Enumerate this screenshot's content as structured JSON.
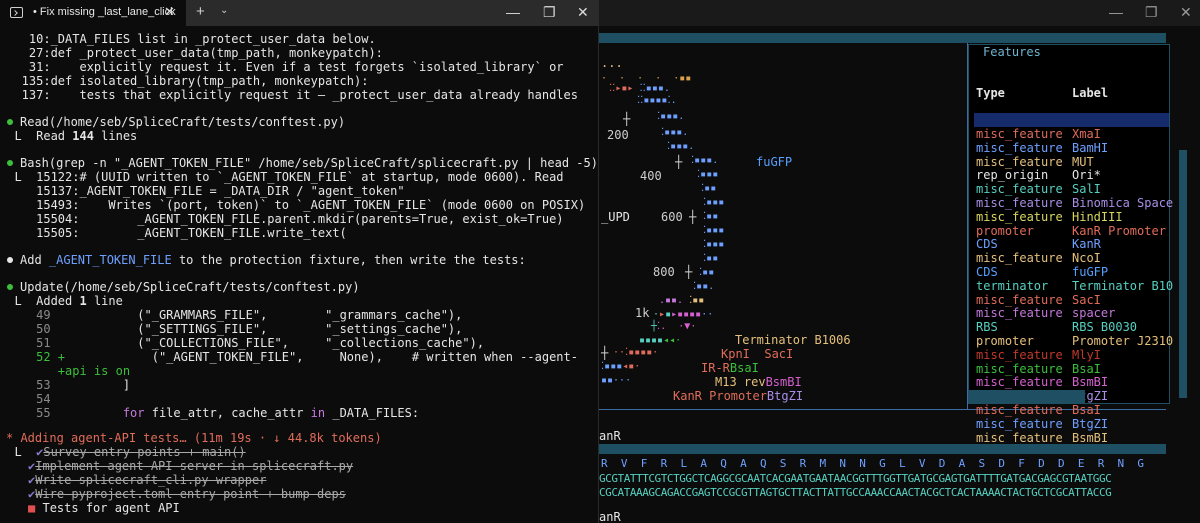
{
  "left_window": {
    "tab_title": "• Fix missing _last_lane_click",
    "close_glyph": "✕",
    "newtab_glyph": "+",
    "dropdown_glyph": "⌄",
    "min_glyph": "—",
    "max_glyph": "❐",
    "winclose_glyph": "✕"
  },
  "terminal": {
    "lines": {
      "l1": "    10:_DATA_FILES list in _protect_user_data below.",
      "l2": "    27:def _protect_user_data(tmp_path, monkeypatch):",
      "l3": "    31:    explicitly request it. Even if a test forgets `isolated_library` or",
      "l4": "   135:def isolated_library(tmp_path, monkeypatch):",
      "l5": "   137:    tests that explicitly request it — _protect_user_data already handles",
      "read_cmd": "Read(/home/seb/SpliceCraft/tests/conftest.py)",
      "read_res_prefix": "  L  Read ",
      "read_res_count": "144",
      "read_res_suffix": " lines",
      "bash_cmd": "Bash(grep -n \"_AGENT_TOKEN_FILE\" /home/seb/SpliceCraft/splicecraft.py | head -5)",
      "b1": "  L  15122:# (UUID written to `_AGENT_TOKEN_FILE` at startup, mode 0600). Read",
      "b2": "     15137:_AGENT_TOKEN_FILE = _DATA_DIR / \"agent_token\"",
      "b3": "     15493:    Writes `(port, token)` to `_AGENT_TOKEN_FILE` (mode 0600 on POSIX)",
      "b4": "     15504:        _AGENT_TOKEN_FILE.parent.mkdir(parents=True, exist_ok=True)",
      "b5": "     15505:        _AGENT_TOKEN_FILE.write_text(",
      "add_prefix": "Add ",
      "add_ident": "_AGENT_TOKEN_FILE",
      "add_suffix": " to the protection fixture, then write the tests:",
      "update_cmd": "Update(/home/seb/SpliceCraft/tests/conftest.py)",
      "added_prefix": "  L  Added ",
      "added_count": "1",
      "added_suffix": " line",
      "d49_num": "     49",
      "d49_code": "            (\"_GRAMMARS_FILE\",        \"_grammars_cache\"),",
      "d50_num": "     50",
      "d50_code": "            (\"_SETTINGS_FILE\",        \"_settings_cache\"),",
      "d51_num": "     51",
      "d51_code": "            (\"_COLLECTIONS_FILE\",     \"_collections_cache\"),",
      "d52_num": "     52 +",
      "d52_code": "            (\"_AGENT_TOKEN_FILE\",     None),    # written when --agent-",
      "d52b": "        +api is on",
      "d53_num": "     53",
      "d53_code": "          ]",
      "d54_num": "     54",
      "d55_num": "     55",
      "d55_for": "          for",
      "d55_mid": " file_attr, cache_attr ",
      "d55_in": "in",
      "d55_end": " _DATA_FILES:",
      "status": "* Adding agent-API tests… (11m 19s · ↓ 44.8k tokens)",
      "todo_lead": "  L  ",
      "todo1": "Survey entry points + main()",
      "todo2": "Implement agent-API server in splicecraft.py",
      "todo3": "Write splicecraft_cli.py wrapper",
      "todo4": "Wire pyproject.toml entry point + bump deps",
      "todo5": "Tests for agent API",
      "check": "✔",
      "square": "■"
    }
  },
  "right_window": {
    "min_glyph": "—",
    "max_glyph": "❐",
    "close_glyph": "✕"
  },
  "map": {
    "ticks": {
      "t200": "200",
      "t400": "400",
      "t600": "600",
      "t800": "800",
      "t1k": "1k"
    },
    "labels": {
      "fugfp": "fuGFP",
      "upd": "_UPD",
      "term": "Terminator B1006",
      "kpni": "KpnI  SacI",
      "irr": "IR-R",
      "bsai": "BsaI",
      "m13": "M13 rev",
      "bsmbi": "BsmBI",
      "kanr_prom": "KanR Promoter",
      "btgzi": "BtgZI",
      "dots_top": "..."
    }
  },
  "features": {
    "title": "Features",
    "col_type": "Type",
    "col_label": "Label",
    "rows": [
      {
        "type": "misc_feature",
        "label": "XmaI",
        "type_color": "#e06c5a",
        "label_color": "#e06c5a"
      },
      {
        "type": "misc_feature",
        "label": "BamHI",
        "type_color": "#6ea0ff",
        "label_color": "#6ea0ff"
      },
      {
        "type": "misc_feature",
        "label": "MUT",
        "type_color": "#e5c07b",
        "label_color": "#e5c07b"
      },
      {
        "type": "rep_origin",
        "label": "Ori*",
        "type_color": "#e6e6e6",
        "label_color": "#e6e6e6"
      },
      {
        "type": "misc_feature",
        "label": "SalI",
        "type_color": "#56d0c0",
        "label_color": "#56d0c0"
      },
      {
        "type": "misc_feature",
        "label": "Binomica Space",
        "type_color": "#a98fe6",
        "label_color": "#a98fe6"
      },
      {
        "type": "misc_feature",
        "label": "HindIII",
        "type_color": "#d8d860",
        "label_color": "#d8d860"
      },
      {
        "type": "promoter",
        "label": "KanR Promoter",
        "type_color": "#e06c5a",
        "label_color": "#e06c5a"
      },
      {
        "type": "CDS",
        "label": "KanR",
        "type_color": "#6ea0ff",
        "label_color": "#6ea0ff"
      },
      {
        "type": "misc_feature",
        "label": "NcoI",
        "type_color": "#e5c07b",
        "label_color": "#e5c07b"
      },
      {
        "type": "CDS",
        "label": "fuGFP",
        "type_color": "#56a0ff",
        "label_color": "#56a0ff"
      },
      {
        "type": "terminator",
        "label": "Terminator B10",
        "type_color": "#56d0c0",
        "label_color": "#56d0c0"
      },
      {
        "type": "misc_feature",
        "label": "SacI",
        "type_color": "#e06c5a",
        "label_color": "#e06c5a"
      },
      {
        "type": "misc_feature",
        "label": "spacer",
        "type_color": "#c678dd",
        "label_color": "#c678dd"
      },
      {
        "type": "RBS",
        "label": "RBS B0030",
        "type_color": "#56d0c0",
        "label_color": "#56d0c0"
      },
      {
        "type": "promoter",
        "label": "Promoter J2310",
        "type_color": "#e5c07b",
        "label_color": "#e5c07b"
      },
      {
        "type": "misc_feature",
        "label": "MlyI",
        "type_color": "#c0392b",
        "label_color": "#c0392b"
      },
      {
        "type": "misc_feature",
        "label": "BsaI",
        "type_color": "#3cbf3c",
        "label_color": "#3cbf3c"
      },
      {
        "type": "misc_feature",
        "label": "BsmBI",
        "type_color": "#d660d0",
        "label_color": "#d660d0"
      },
      {
        "type": "misc_feature",
        "label": "BtgZI",
        "type_color": "#a98fe6",
        "label_color": "#a98fe6"
      },
      {
        "type": "misc_feature",
        "label": "BsaI",
        "type_color": "#e06c5a",
        "label_color": "#e06c5a"
      },
      {
        "type": "misc_feature",
        "label": "BtgZI",
        "type_color": "#6ea0ff",
        "label_color": "#6ea0ff"
      },
      {
        "type": "misc_feature",
        "label": "BsmBI",
        "type_color": "#e5c07b",
        "label_color": "#e5c07b"
      }
    ]
  },
  "sequence": {
    "kanr_top": "anR",
    "aa": "R  V  F  R  L  A  Q  A  Q  S  R  M  N  N  G  L  V  D  A  S  D  F  D  D  E  R  N  G",
    "dna_top": "GCGTATTTCGTCTGGCTCAGGCGCAATCACGAATGAATAACGGTTTGGTTGATGCGAGTGATTTTGATGACGAGCGTAATGGC",
    "dna_bot": "CGCATAAAGCAGACCGAGTCCGCGTTAGTGCTTACTTATTGCCAAACCAACTACGCTCACTAAAACTACTGCTCGCATTACCG",
    "kanr_bottom": "anR"
  }
}
